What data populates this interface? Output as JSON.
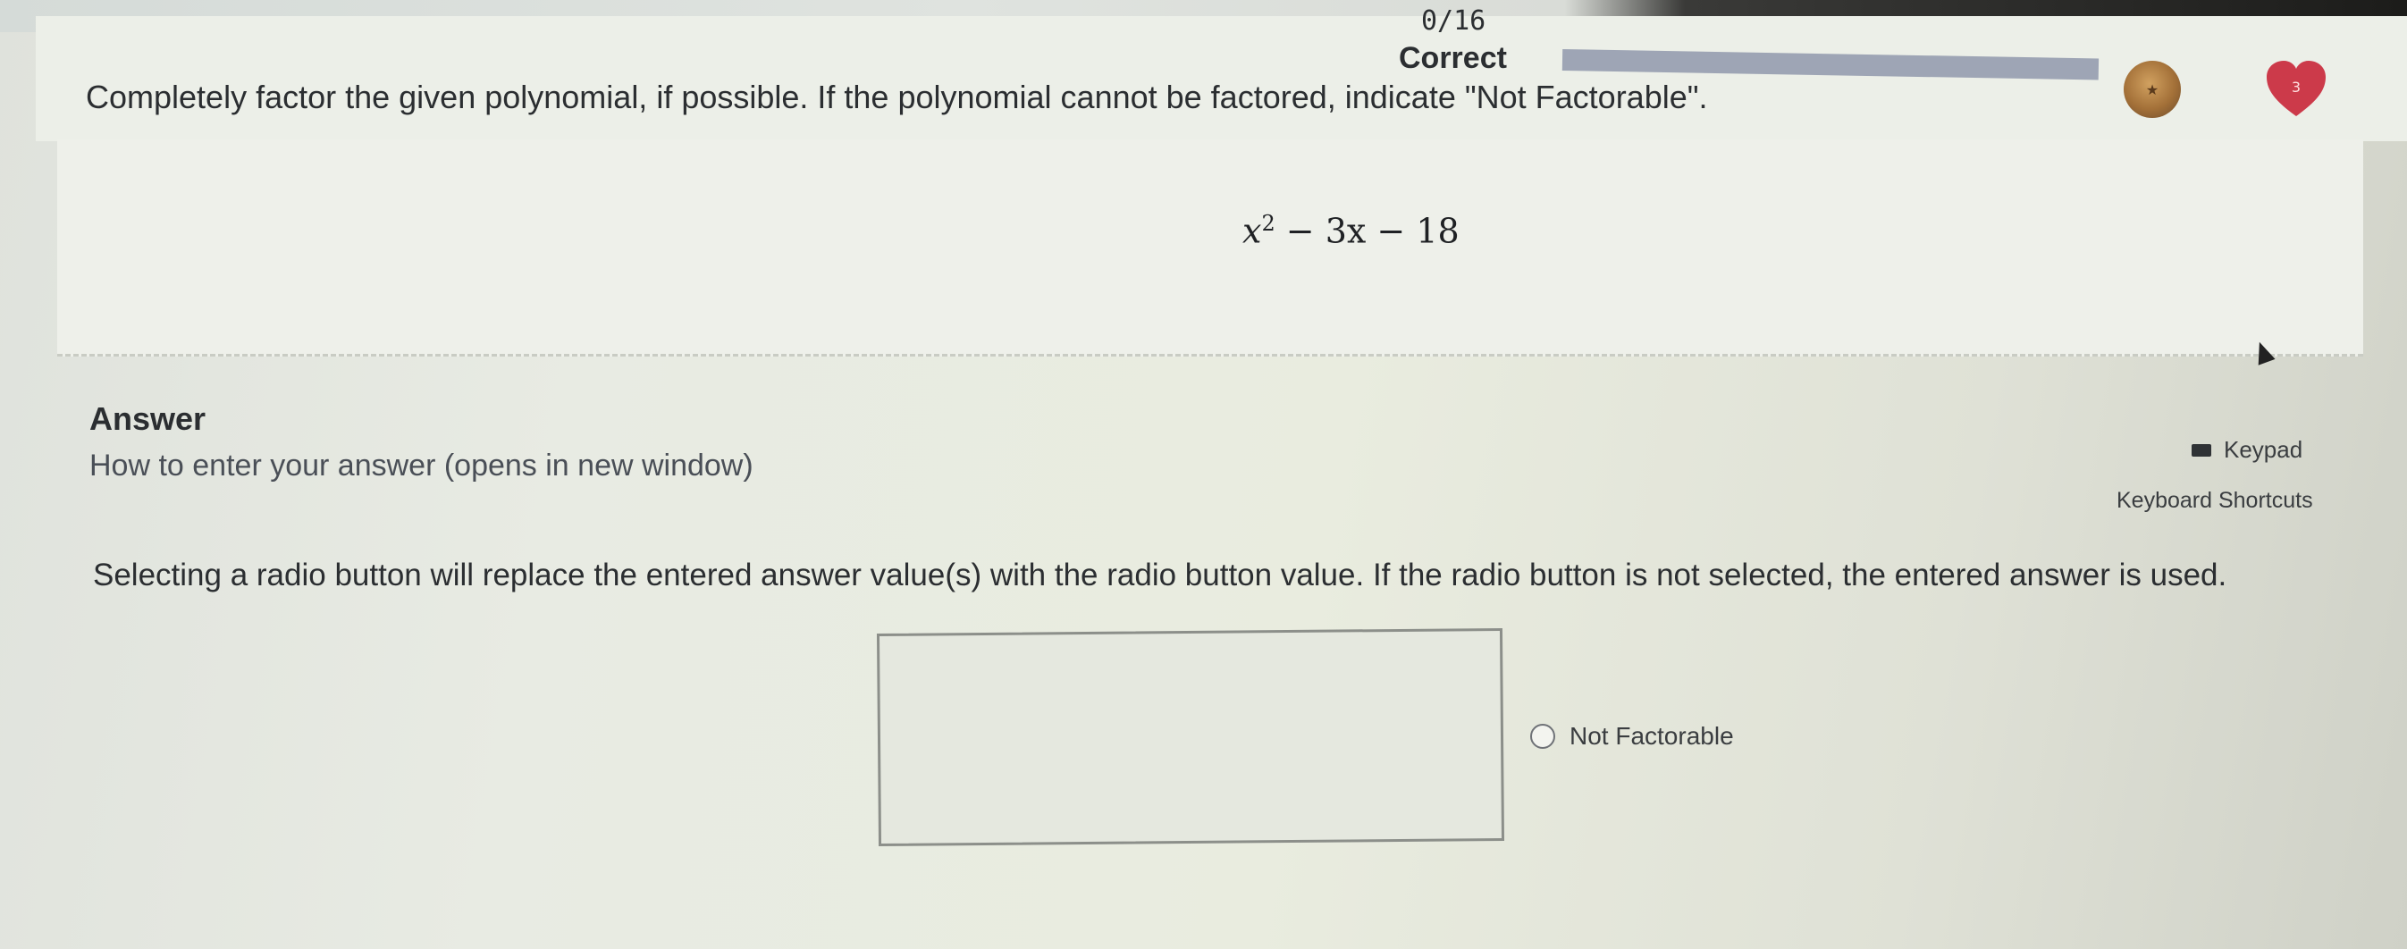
{
  "header": {
    "score": "0/16",
    "status": "Correct",
    "hearts_count": "3"
  },
  "question": {
    "prompt": "Completely factor the given polynomial, if possible. If the polynomial cannot be factored, indicate \"Not Factorable\".",
    "expression": {
      "base": "x",
      "exponent": "2",
      "rest": " − 3x − 18"
    }
  },
  "answer": {
    "heading": "Answer",
    "help_link": "How to enter your answer (opens in new window)",
    "keypad_label": "Keypad",
    "shortcuts_label": "Keyboard Shortcuts",
    "instruction": "Selecting a radio button will replace the entered answer value(s) with the radio button value. If the radio button is not selected, the entered answer is used.",
    "input_value": "",
    "radio_option": "Not Factorable"
  },
  "icons": {
    "streak": "streak-medal-icon",
    "hearts": "heart-icon",
    "keypad": "keypad-icon",
    "radio": "radio-icon"
  },
  "colors": {
    "heart": "#cc3a4a",
    "progress": "#9ea5b5"
  }
}
